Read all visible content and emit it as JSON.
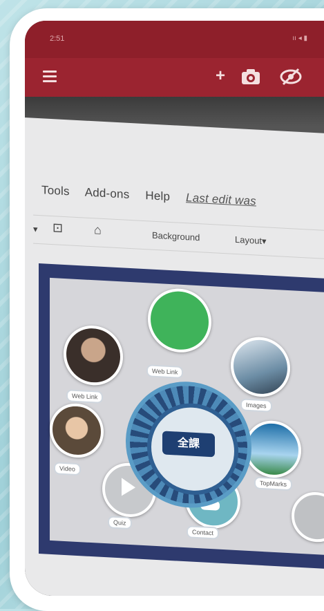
{
  "status_bar": {
    "time": "2:51",
    "icons": "ıı ◂ ▮"
  },
  "app_bar": {
    "menu_icon": "menu-icon",
    "plus": "+",
    "camera_icon": "camera-icon",
    "eye_icon": "visibility-off-icon"
  },
  "doc_menu": {
    "tools": "Tools",
    "addons": "Add-ons",
    "help": "Help",
    "last_edit": "Last edit was"
  },
  "toolbar": {
    "background": "Background",
    "layout": "Layout▾"
  },
  "slide": {
    "chips": [
      "Web Link",
      "Web Link",
      "Video",
      "Images",
      "TopMarks",
      "Quiz",
      "Contact"
    ],
    "hub_text": "全課"
  },
  "colors": {
    "status": "#8e1f2a",
    "appbar": "#9b2430",
    "accent_green": "#3fb35a",
    "hub_blue": "#2f5f92"
  }
}
